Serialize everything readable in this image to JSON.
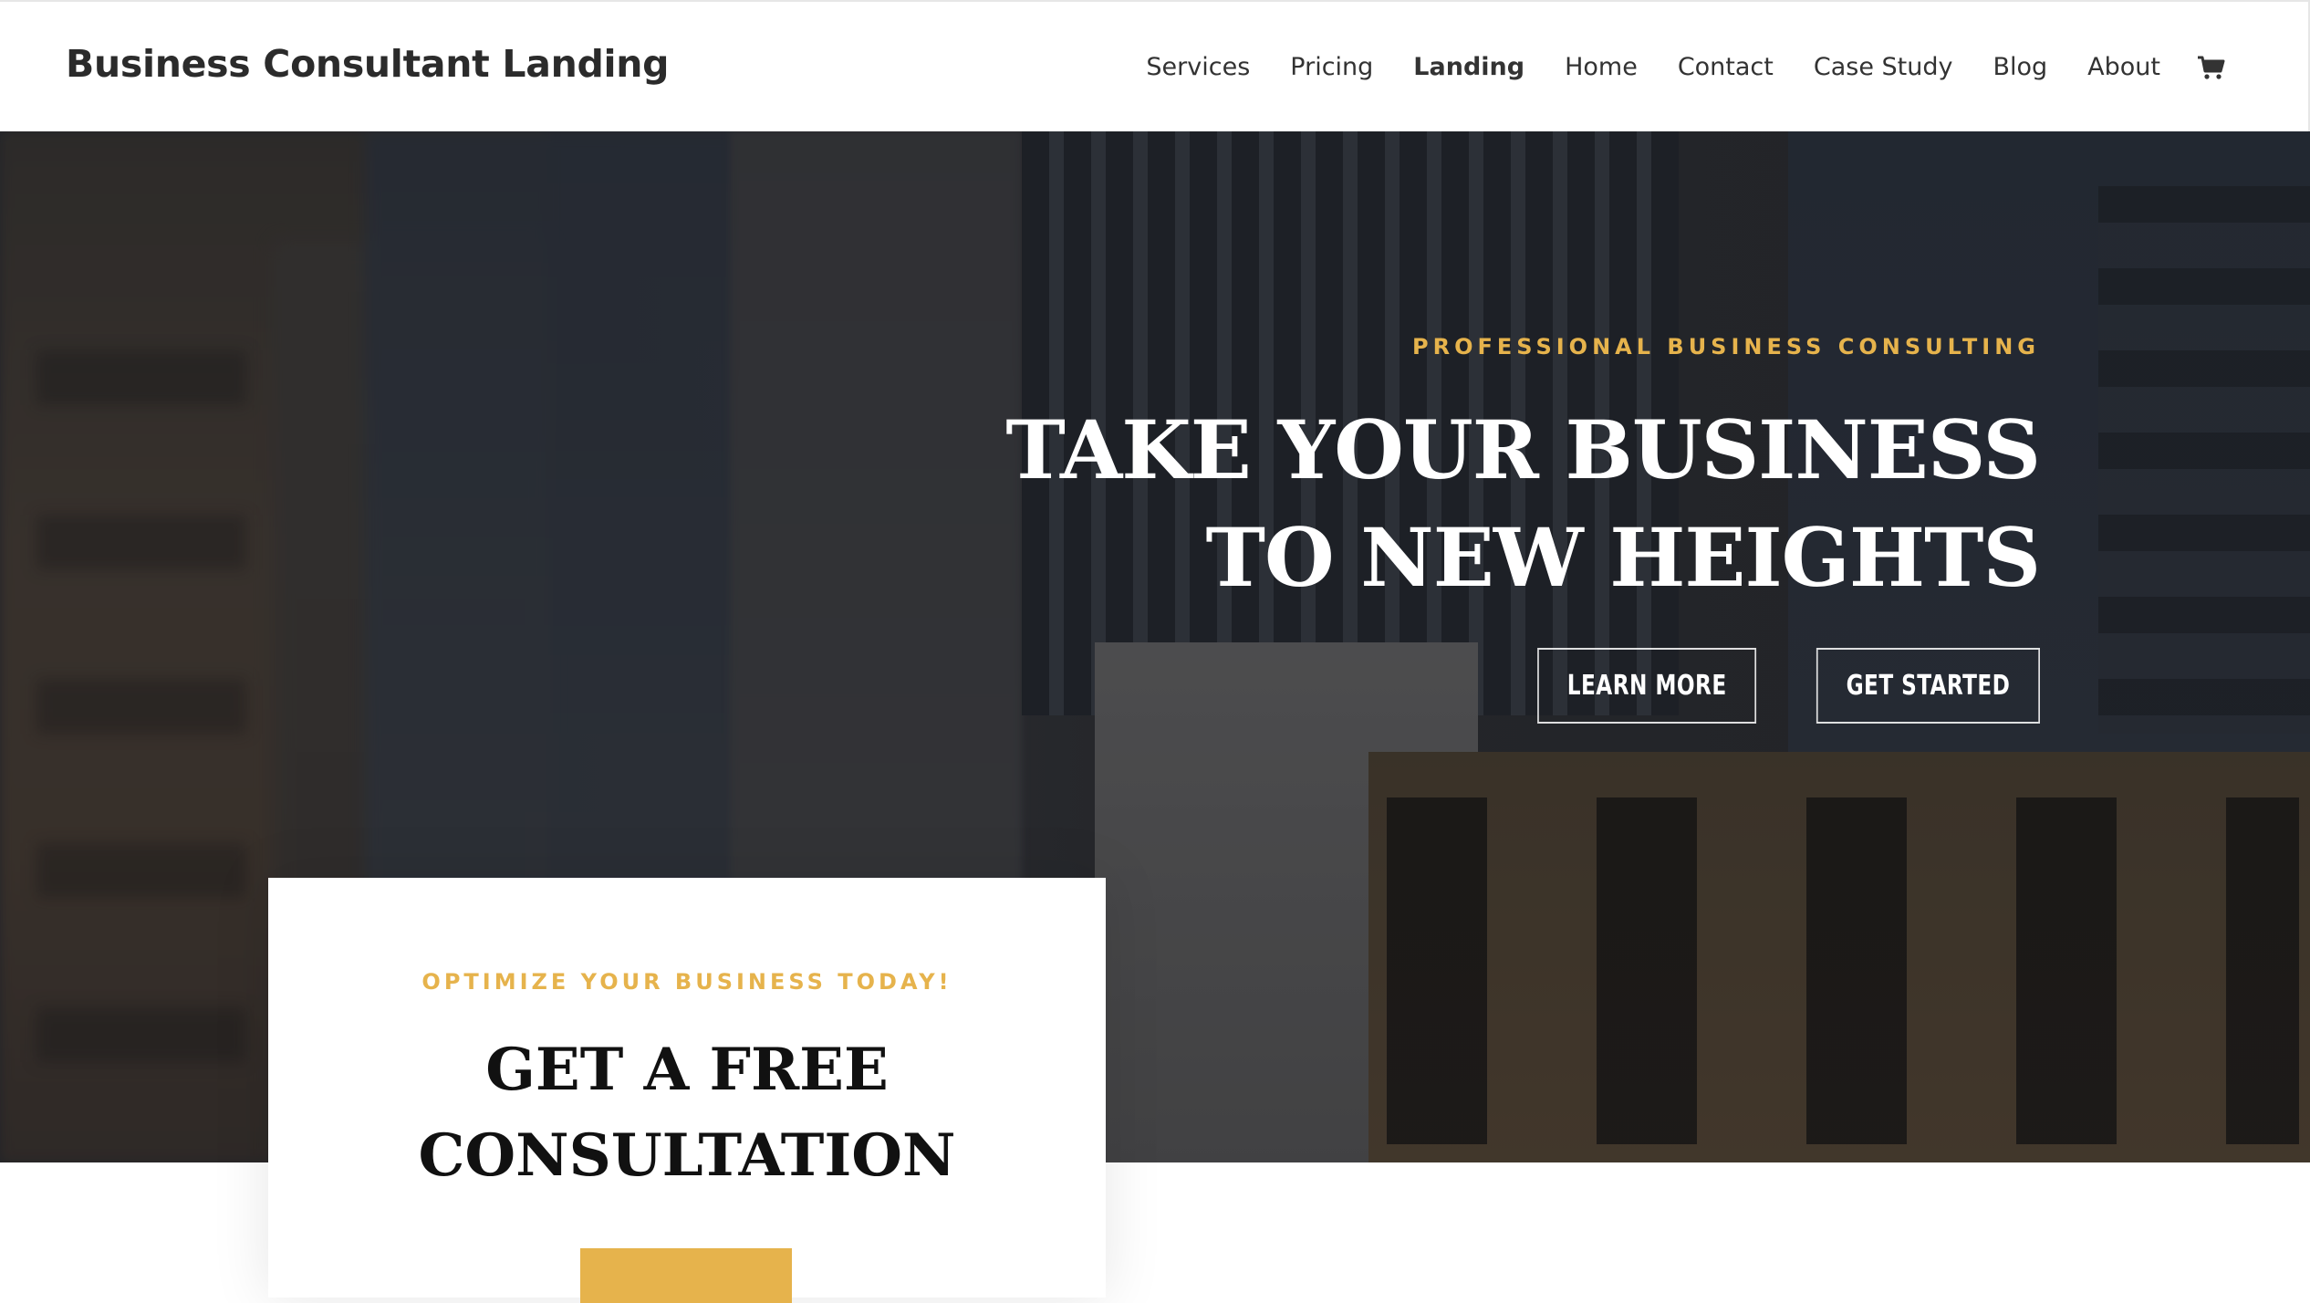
{
  "header": {
    "logo": "Business Consultant Landing",
    "nav": [
      "Services",
      "Pricing",
      "Landing",
      "Home",
      "Contact",
      "Case Study",
      "Blog",
      "About"
    ],
    "active_nav": "Landing",
    "cart_icon": "cart-icon"
  },
  "hero": {
    "eyebrow": "PROFESSIONAL BUSINESS CONSULTING",
    "title_line1": "TAKE YOUR BUSINESS",
    "title_line2": "TO NEW HEIGHTS",
    "btn_learn": "LEARN MORE",
    "btn_start": "GET STARTED"
  },
  "card": {
    "eyebrow": "OPTIMIZE YOUR BUSINESS TODAY!",
    "title_line1": "GET A FREE",
    "title_line2": "CONSULTATION"
  },
  "colors": {
    "accent": "#e6b34c",
    "text_dark": "#2b2b2b"
  }
}
